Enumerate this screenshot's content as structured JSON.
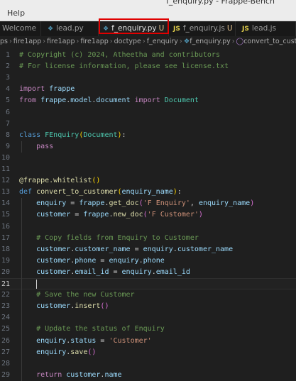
{
  "window": {
    "title": "f_enquiry.py - Frappe-Bench"
  },
  "menu": {
    "help_label": "Help"
  },
  "tabs": [
    {
      "label": "Welcome",
      "icon": "vscode-icon",
      "lang": "",
      "modified": ""
    },
    {
      "label": "lead.py",
      "icon": "python-file-icon",
      "lang": "py",
      "modified": ""
    },
    {
      "label": "f_enquiry.py",
      "icon": "python-file-icon",
      "lang": "py",
      "modified": "U",
      "active": true,
      "dirty": true
    },
    {
      "label": "f_enquiry.js",
      "icon": "javascript-file-icon",
      "lang": "JS",
      "modified": "U"
    },
    {
      "label": "lead.js",
      "icon": "javascript-file-icon",
      "lang": "JS",
      "modified": ""
    }
  ],
  "breadcrumb": [
    "ps",
    "fire1app",
    "fire1app",
    "fire1app",
    "doctype",
    "f_enquiry",
    "f_enquiry.py",
    "convert_to_customer"
  ],
  "colors": {
    "editor_bg": "#1f1f1f",
    "highlight_box": "#e00000",
    "keyword": "#569cd6",
    "control_keyword": "#c586c0",
    "class": "#4ec9b0",
    "function": "#dcdcaa",
    "variable": "#9cdcfe",
    "string": "#ce9178",
    "comment": "#6a9955"
  },
  "editor": {
    "current_line": 21,
    "lines": [
      {
        "n": "1",
        "tokens": [
          [
            "com",
            "# Copyright (c) 2024, Atheetha and contributors"
          ]
        ]
      },
      {
        "n": "2",
        "tokens": [
          [
            "com",
            "# For license information, please see license.txt"
          ]
        ]
      },
      {
        "n": "3",
        "tokens": []
      },
      {
        "n": "4",
        "tokens": [
          [
            "ctl",
            "import"
          ],
          [
            "op",
            " "
          ],
          [
            "var",
            "frappe"
          ]
        ]
      },
      {
        "n": "5",
        "tokens": [
          [
            "ctl",
            "from"
          ],
          [
            "op",
            " "
          ],
          [
            "var",
            "frappe"
          ],
          [
            "op",
            "."
          ],
          [
            "var",
            "model"
          ],
          [
            "op",
            "."
          ],
          [
            "var",
            "document"
          ],
          [
            "op",
            " "
          ],
          [
            "ctl",
            "import"
          ],
          [
            "op",
            " "
          ],
          [
            "cls",
            "Document"
          ]
        ]
      },
      {
        "n": "6",
        "tokens": []
      },
      {
        "n": "7",
        "tokens": []
      },
      {
        "n": "8",
        "tokens": [
          [
            "kw",
            "class"
          ],
          [
            "op",
            " "
          ],
          [
            "cls",
            "FEnquiry"
          ],
          [
            "p1",
            "("
          ],
          [
            "cls",
            "Document"
          ],
          [
            "p1",
            ")"
          ],
          [
            "op",
            ":"
          ]
        ]
      },
      {
        "n": "9",
        "tokens": [
          [
            "op",
            "    "
          ],
          [
            "ctl",
            "pass"
          ]
        ]
      },
      {
        "n": "10",
        "tokens": []
      },
      {
        "n": "11",
        "tokens": []
      },
      {
        "n": "12",
        "tokens": [
          [
            "dec",
            "@frappe.whitelist"
          ],
          [
            "p1",
            "()"
          ]
        ]
      },
      {
        "n": "13",
        "tokens": [
          [
            "kw",
            "def"
          ],
          [
            "op",
            " "
          ],
          [
            "fn",
            "convert_to_customer"
          ],
          [
            "p1",
            "("
          ],
          [
            "var",
            "enquiry_name"
          ],
          [
            "p1",
            ")"
          ],
          [
            "op",
            ":"
          ]
        ]
      },
      {
        "n": "14",
        "tokens": [
          [
            "op",
            "    "
          ],
          [
            "var",
            "enquiry"
          ],
          [
            "op",
            " = "
          ],
          [
            "var",
            "frappe"
          ],
          [
            "op",
            "."
          ],
          [
            "fn",
            "get_doc"
          ],
          [
            "p2",
            "("
          ],
          [
            "str",
            "'F Enquiry'"
          ],
          [
            "op",
            ", "
          ],
          [
            "var",
            "enquiry_name"
          ],
          [
            "p2",
            ")"
          ]
        ]
      },
      {
        "n": "15",
        "tokens": [
          [
            "op",
            "    "
          ],
          [
            "var",
            "customer"
          ],
          [
            "op",
            " = "
          ],
          [
            "var",
            "frappe"
          ],
          [
            "op",
            "."
          ],
          [
            "fn",
            "new_doc"
          ],
          [
            "p2",
            "("
          ],
          [
            "str",
            "'F Customer'"
          ],
          [
            "p2",
            ")"
          ]
        ]
      },
      {
        "n": "16",
        "tokens": []
      },
      {
        "n": "17",
        "tokens": [
          [
            "op",
            "    "
          ],
          [
            "com",
            "# Copy fields from Enquiry to Customer"
          ]
        ]
      },
      {
        "n": "18",
        "tokens": [
          [
            "op",
            "    "
          ],
          [
            "var",
            "customer"
          ],
          [
            "op",
            "."
          ],
          [
            "var",
            "customer_name"
          ],
          [
            "op",
            " = "
          ],
          [
            "var",
            "enquiry"
          ],
          [
            "op",
            "."
          ],
          [
            "var",
            "customer_name"
          ]
        ]
      },
      {
        "n": "19",
        "tokens": [
          [
            "op",
            "    "
          ],
          [
            "var",
            "customer"
          ],
          [
            "op",
            "."
          ],
          [
            "var",
            "phone"
          ],
          [
            "op",
            " = "
          ],
          [
            "var",
            "enquiry"
          ],
          [
            "op",
            "."
          ],
          [
            "var",
            "phone"
          ]
        ]
      },
      {
        "n": "20",
        "tokens": [
          [
            "op",
            "    "
          ],
          [
            "var",
            "customer"
          ],
          [
            "op",
            "."
          ],
          [
            "var",
            "email_id"
          ],
          [
            "op",
            " = "
          ],
          [
            "var",
            "enquiry"
          ],
          [
            "op",
            "."
          ],
          [
            "var",
            "email_id"
          ]
        ]
      },
      {
        "n": "21",
        "tokens": [
          [
            "op",
            "    "
          ]
        ],
        "cursor": true
      },
      {
        "n": "22",
        "tokens": [
          [
            "op",
            "    "
          ],
          [
            "com",
            "# Save the new Customer"
          ]
        ]
      },
      {
        "n": "23",
        "tokens": [
          [
            "op",
            "    "
          ],
          [
            "var",
            "customer"
          ],
          [
            "op",
            "."
          ],
          [
            "fn",
            "insert"
          ],
          [
            "p2",
            "()"
          ]
        ]
      },
      {
        "n": "24",
        "tokens": []
      },
      {
        "n": "25",
        "tokens": [
          [
            "op",
            "    "
          ],
          [
            "com",
            "# Update the status of Enquiry"
          ]
        ]
      },
      {
        "n": "26",
        "tokens": [
          [
            "op",
            "    "
          ],
          [
            "var",
            "enquiry"
          ],
          [
            "op",
            "."
          ],
          [
            "var",
            "status"
          ],
          [
            "op",
            " = "
          ],
          [
            "str",
            "'Customer'"
          ]
        ]
      },
      {
        "n": "27",
        "tokens": [
          [
            "op",
            "    "
          ],
          [
            "var",
            "enquiry"
          ],
          [
            "op",
            "."
          ],
          [
            "fn",
            "save"
          ],
          [
            "p2",
            "()"
          ]
        ]
      },
      {
        "n": "28",
        "tokens": []
      },
      {
        "n": "29",
        "tokens": [
          [
            "op",
            "    "
          ],
          [
            "ctl",
            "return"
          ],
          [
            "op",
            " "
          ],
          [
            "var",
            "customer"
          ],
          [
            "op",
            "."
          ],
          [
            "var",
            "name"
          ]
        ]
      }
    ]
  }
}
